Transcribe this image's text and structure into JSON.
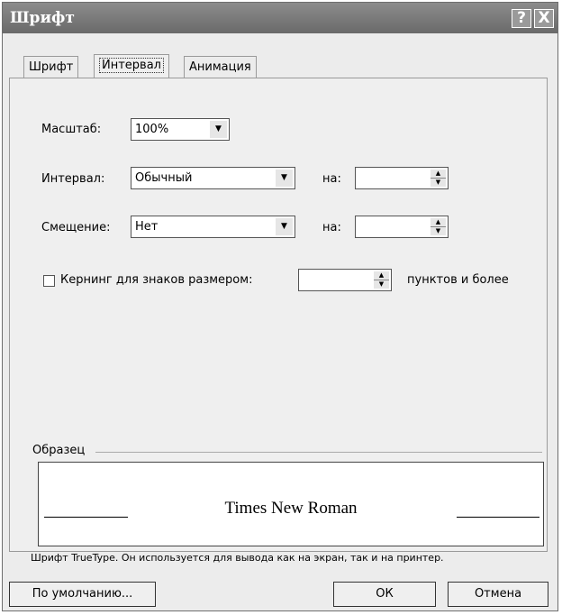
{
  "window": {
    "title": "Шрифт",
    "help_symbol": "?",
    "close_symbol": "X"
  },
  "tabs": [
    {
      "label": "Шрифт",
      "active": false
    },
    {
      "label": "Интервал",
      "active": true
    },
    {
      "label": "Анимация",
      "active": false
    }
  ],
  "scale": {
    "label": "Масштаб:",
    "value": "100%"
  },
  "spacing": {
    "label": "Интервал:",
    "value": "Обычный",
    "by_label": "на:",
    "by_value": ""
  },
  "position": {
    "label": "Смещение:",
    "value": "Нет",
    "by_label": "на:",
    "by_value": ""
  },
  "kerning": {
    "label": "Кернинг для знаков размером:",
    "checked": false,
    "value": "",
    "suffix": "пунктов и более"
  },
  "preview": {
    "legend": "Образец",
    "sample_text": "Times New Roman",
    "note": "Шрифт TrueType. Он используется для вывода как на экран, так и на принтер."
  },
  "buttons": {
    "default": "По умолчанию...",
    "ok": "ОК",
    "cancel": "Отмена"
  }
}
